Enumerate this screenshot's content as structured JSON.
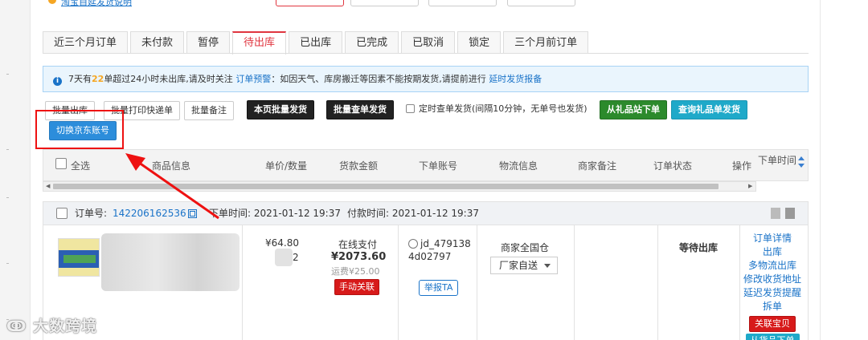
{
  "top": {
    "link_text": "淘宝自延发货说明"
  },
  "tabs": [
    {
      "label": "近三个月订单",
      "active": false
    },
    {
      "label": "未付款",
      "active": false
    },
    {
      "label": "暂停",
      "active": false
    },
    {
      "label": "待出库",
      "active": true
    },
    {
      "label": "已出库",
      "active": false
    },
    {
      "label": "已完成",
      "active": false
    },
    {
      "label": "已取消",
      "active": false
    },
    {
      "label": "锁定",
      "active": false
    },
    {
      "label": "三个月前订单",
      "active": false
    }
  ],
  "notice": {
    "prefix": "7天有",
    "count": "22",
    "middle": "单超过24小时未出库,请及时关注",
    "warning_link": "订单预警",
    "body": "：如因天气、库房搬迁等因素不能按期发货,请提前进行",
    "delay_link": "延时发货报备"
  },
  "toolbar": {
    "batch_out": "批量出库",
    "batch_print": "批量打印快递单",
    "batch_note": "批量备注",
    "page_batch_ship": "本页批量发货",
    "batch_check_ship": "批量查单发货",
    "timed_check": "定时查单发货(间隔10分钟，无单号也发货)",
    "gift_order": "从礼品站下单",
    "query_gift": "查询礼品单发货",
    "switch_jd": "切换京东账号"
  },
  "table_header": {
    "select_all": "全选",
    "product_info": "商品信息",
    "unit_qty": "单价/数量",
    "amount": "货款金额",
    "buyer": "下单账号",
    "logistics": "物流信息",
    "merchant_note": "商家备注",
    "order_status": "订单状态",
    "actions": "操作",
    "order_time": "下单时间"
  },
  "order": {
    "no_label": "订单号:",
    "no": "142206162536",
    "order_time": "下单时间: 2021-01-12 19:37",
    "pay_time": "付款时间: 2021-01-12 19:37",
    "price": "¥64.80",
    "qty_partial": "2",
    "pay_method": "在线支付",
    "pay_amount": "¥2073.60",
    "freight": "运费¥25.00",
    "manual_link": "手动关联",
    "buyer_id": "jd_4791384d02797",
    "report_btn": "举报TA",
    "warehouse": "商家全国仓",
    "ship_option": "厂家自送",
    "status": "等待出库",
    "actions": [
      "订单详情",
      "出库",
      "多物流出库",
      "修改收货地址",
      "延迟发货提醒",
      "拆单"
    ],
    "relate_btn": "关联宝贝",
    "next_btn": "从货品下单"
  },
  "watermark": "大数跨境",
  "colors": {
    "accent_red": "#e0353f",
    "link_blue": "#1a73c8",
    "notice_bg": "#eaf5fd",
    "highlight": "#f5a623"
  }
}
